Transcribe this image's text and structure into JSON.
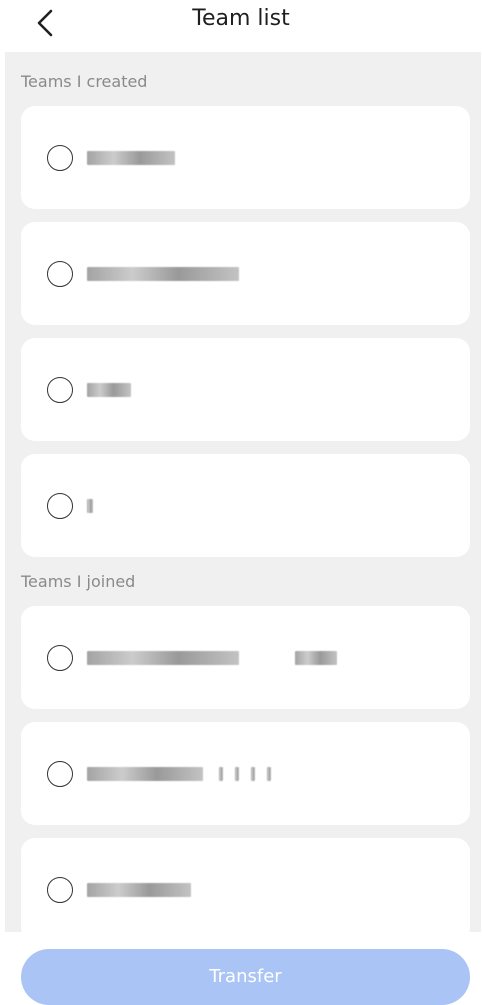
{
  "header": {
    "title": "Team list",
    "back_icon": "chevron-left-icon"
  },
  "sections": {
    "created_label": "Teams I created",
    "joined_label": "Teams I joined"
  },
  "created_teams": [
    {
      "name_redacted": true
    },
    {
      "name_redacted": true
    },
    {
      "name_redacted": true
    },
    {
      "name_redacted": true
    }
  ],
  "joined_teams": [
    {
      "name_redacted": true
    },
    {
      "name_redacted": true
    },
    {
      "name_redacted": true
    }
  ],
  "footer": {
    "transfer_label": "Transfer"
  },
  "colors": {
    "accent_disabled": "#a9c4f5",
    "page_bg": "#f0f0f0",
    "card_bg": "#ffffff",
    "label_gray": "#8a8a8a"
  }
}
